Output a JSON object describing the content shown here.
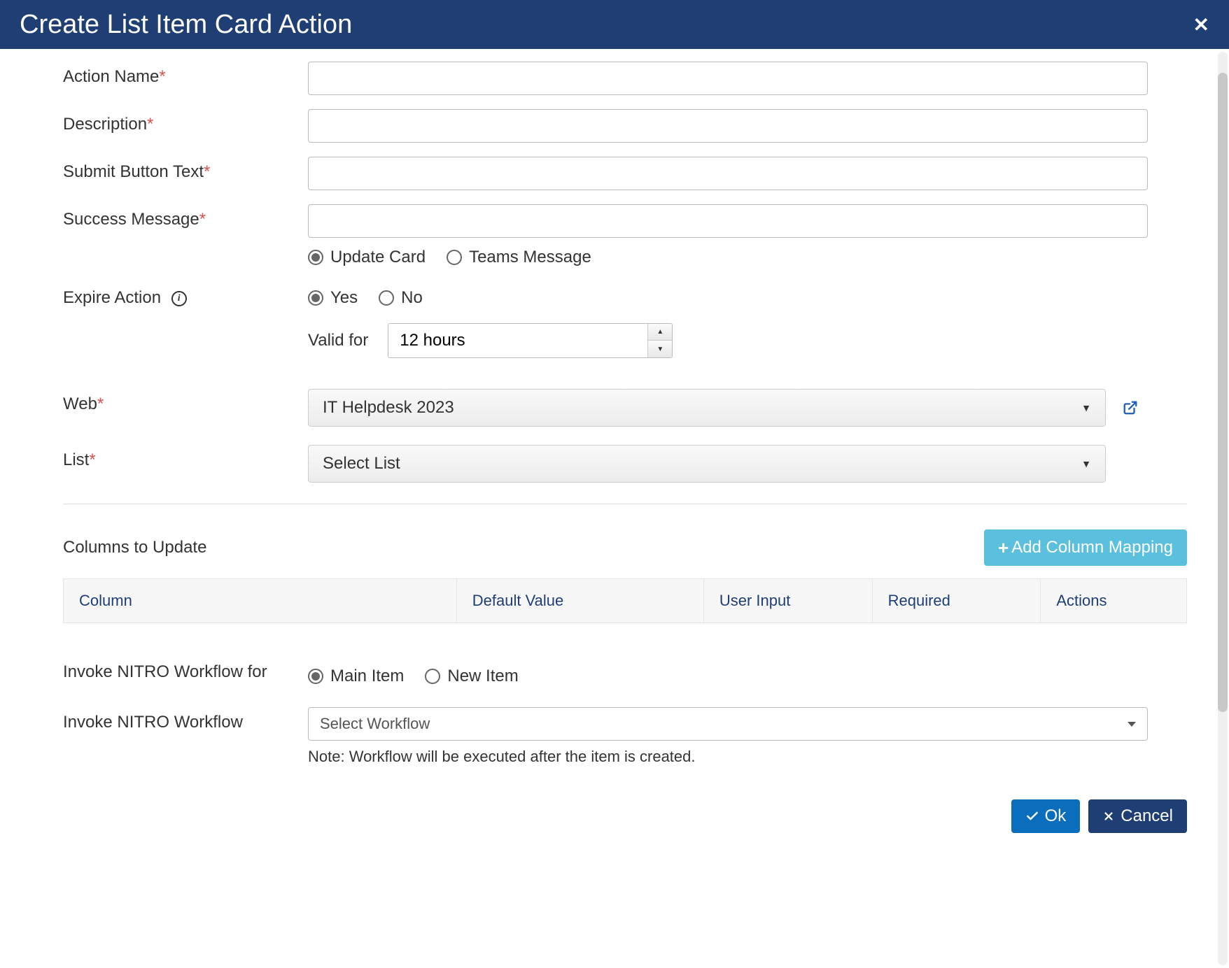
{
  "header": {
    "title": "Create List Item Card Action"
  },
  "fields": {
    "action_name": {
      "label": "Action Name",
      "value": ""
    },
    "description": {
      "label": "Description",
      "value": ""
    },
    "submit_button_text": {
      "label": "Submit Button Text",
      "value": ""
    },
    "success_message": {
      "label": "Success Message",
      "value": ""
    },
    "message_type": {
      "update_card": "Update Card",
      "teams_message": "Teams Message",
      "selected": "update_card"
    },
    "expire_action": {
      "label": "Expire Action",
      "yes": "Yes",
      "no": "No",
      "selected": "yes",
      "valid_for_label": "Valid for",
      "valid_for_value": "12 hours"
    },
    "web": {
      "label": "Web",
      "selected": "IT Helpdesk 2023"
    },
    "list": {
      "label": "List",
      "selected": "Select List"
    },
    "columns_to_update": {
      "label": "Columns to Update",
      "add_button": "Add Column Mapping",
      "headers": [
        "Column",
        "Default Value",
        "User Input",
        "Required",
        "Actions"
      ]
    },
    "invoke_workflow_for": {
      "label": "Invoke NITRO Workflow for",
      "main_item": "Main Item",
      "new_item": "New Item",
      "selected": "main_item"
    },
    "invoke_workflow": {
      "label": "Invoke NITRO Workflow",
      "selected": "Select Workflow",
      "note": "Note: Workflow will be executed after the item is created."
    }
  },
  "footer": {
    "ok": "Ok",
    "cancel": "Cancel"
  }
}
